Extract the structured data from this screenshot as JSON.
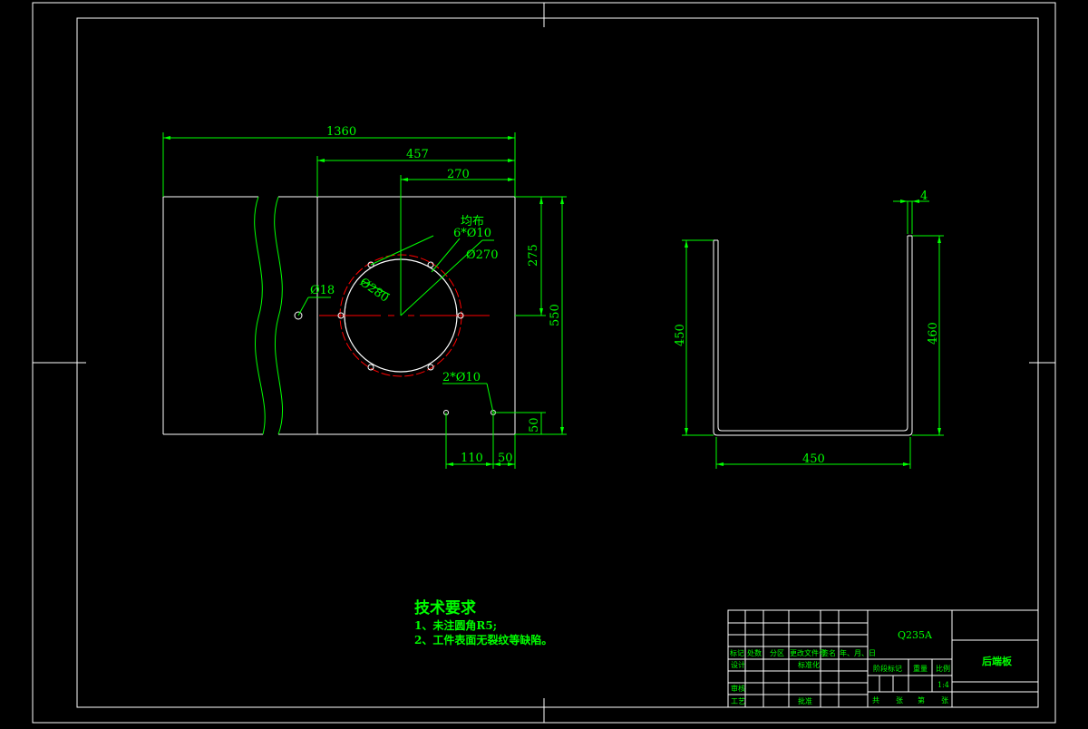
{
  "colors": {
    "background": "#000000",
    "outline": "#ffffff",
    "dimension": "#00ff00",
    "centerline": "#ff0000"
  },
  "plan_view": {
    "overall_width": "1360",
    "width_457": "457",
    "width_270": "270",
    "hole_pattern_label_1": "均布",
    "hole_pattern_label_2": "6*Ø10",
    "dia_270": "Ø270",
    "dia_280": "Ø280",
    "dia_18": "Ø18",
    "height_275": "275",
    "height_550": "550",
    "bottom_holes": "2*Ø10",
    "height_50": "50",
    "offset_110": "110",
    "offset_50": "50"
  },
  "side_view": {
    "thickness": "4",
    "left_height": "450",
    "right_height": "460",
    "bottom_width": "450"
  },
  "technical_requirements": {
    "title": "技术要求",
    "items": [
      "1、未注圆角R5;",
      "2、工件表面无裂纹等缺陷。"
    ]
  },
  "title_block": {
    "material": "Q235A",
    "part_name": "后端板",
    "scale": "1:4",
    "row_labels": [
      "标记",
      "处数",
      "分区",
      "更改文件号",
      "签名",
      "年、月、日"
    ],
    "design": "设计",
    "standardization": "标准化",
    "stage_mark": "阶段标记",
    "weight": "重量",
    "scale_label": "比例",
    "review": "审核",
    "process": "工艺",
    "approve": "批准",
    "sheet_info": [
      "共",
      "张",
      "第",
      "张"
    ]
  }
}
